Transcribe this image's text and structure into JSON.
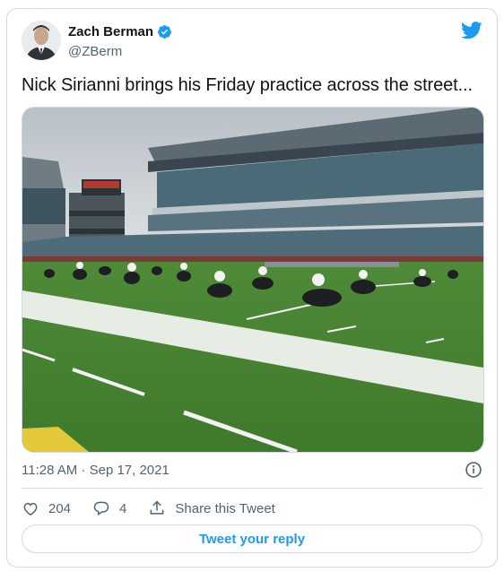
{
  "author": {
    "name": "Zach Berman",
    "handle": "@ZBerm",
    "verified": true
  },
  "tweet": {
    "text": "Nick Sirianni brings his Friday practice across the street...",
    "timestamp": "11:28 AM · Sep 17, 2021"
  },
  "actions": {
    "likes": "204",
    "replies": "4",
    "share_label": "Share this Tweet"
  },
  "reply_button": {
    "label": "Tweet your reply"
  },
  "colors": {
    "accent": "#1d9bf0",
    "secondary_text": "#536471",
    "border": "#cfd9de"
  },
  "icons": [
    "verified-badge-icon",
    "twitter-bird-icon",
    "info-icon",
    "heart-icon",
    "reply-bubble-icon",
    "share-icon"
  ]
}
